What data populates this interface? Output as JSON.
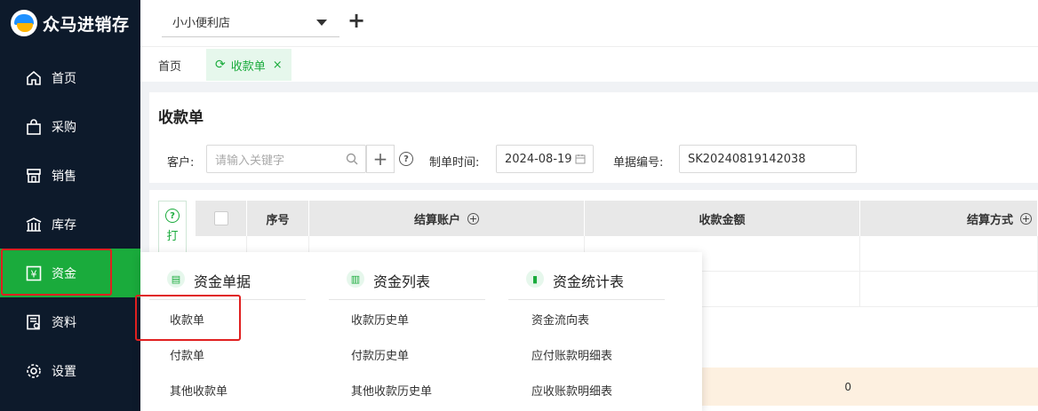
{
  "app": {
    "name": "众马进销存"
  },
  "sidebar": {
    "items": [
      {
        "label": "首页",
        "icon": "home-icon"
      },
      {
        "label": "采购",
        "icon": "bag-icon"
      },
      {
        "label": "销售",
        "icon": "store-icon"
      },
      {
        "label": "库存",
        "icon": "warehouse-icon"
      },
      {
        "label": "资金",
        "icon": "yen-icon",
        "active": true
      },
      {
        "label": "资料",
        "icon": "profile-doc-icon"
      },
      {
        "label": "设置",
        "icon": "gear-icon"
      }
    ]
  },
  "topbar": {
    "store": "小小便利店",
    "add_label": "+"
  },
  "tabs": {
    "home": "首页",
    "active": "收款单",
    "close": "×"
  },
  "form": {
    "title": "收款单",
    "customer_label": "客户:",
    "customer_placeholder": "请输入关键字",
    "date_label": "制单时间:",
    "date_value": "2024-08-19",
    "number_label": "单据编号:",
    "number_value": "SK20240819142038"
  },
  "table": {
    "print_label": "打",
    "columns": [
      "序号",
      "结算账户",
      "收款金额",
      "结算方式"
    ],
    "total_amount": "0"
  },
  "dropdown": {
    "columns": [
      {
        "title": "资金单据",
        "items": [
          "收款单",
          "付款单",
          "其他收款单"
        ]
      },
      {
        "title": "资金列表",
        "items": [
          "收款历史单",
          "付款历史单",
          "其他收款历史单"
        ]
      },
      {
        "title": "资金统计表",
        "items": [
          "资金流向表",
          "应付账款明细表",
          "应收账款明细表"
        ]
      }
    ]
  },
  "colors": {
    "accent": "#1aab3c",
    "sidebar_bg": "#0d1a2b",
    "highlight_border": "#e02020"
  }
}
